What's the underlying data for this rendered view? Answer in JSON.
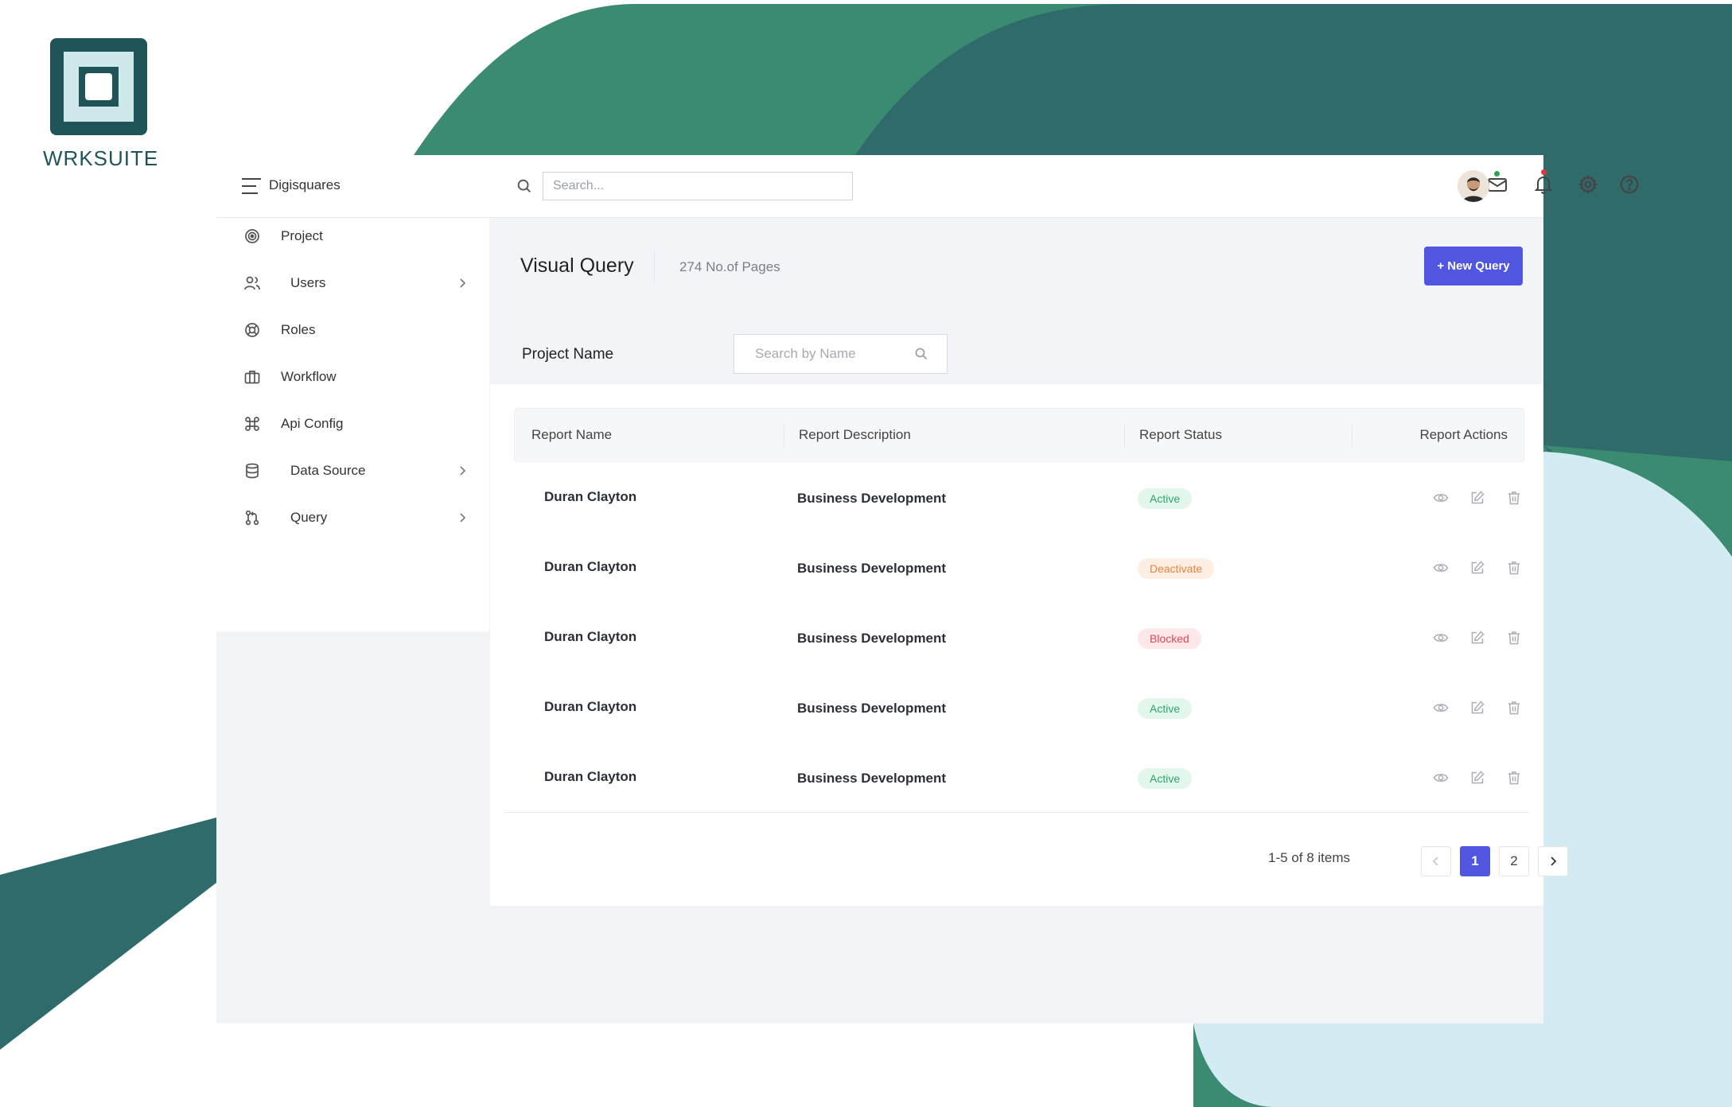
{
  "brand": {
    "name": "WRKSUITE",
    "logo_icon": "square-logo"
  },
  "colors": {
    "accent": "#5156e0",
    "brand_dark": "#1f5558",
    "active": "#29a86a",
    "deactivate": "#e68540",
    "blocked": "#dc4756"
  },
  "topbar": {
    "org_name": "Digisquares",
    "search_placeholder": "Search...",
    "icons": [
      "menu-icon",
      "search-icon",
      "mail-icon",
      "bell-icon",
      "gear-icon",
      "help-icon",
      "avatar"
    ]
  },
  "sidebar": {
    "items": [
      {
        "label": "Project",
        "icon": "target-icon",
        "has_submenu": false
      },
      {
        "label": "Users",
        "icon": "users-icon",
        "has_submenu": true
      },
      {
        "label": "Roles",
        "icon": "lifebuoy-icon",
        "has_submenu": false
      },
      {
        "label": "Workflow",
        "icon": "briefcase-icon",
        "has_submenu": false
      },
      {
        "label": "Api Config",
        "icon": "command-icon",
        "has_submenu": false
      },
      {
        "label": "Data Source",
        "icon": "database-icon",
        "has_submenu": true
      },
      {
        "label": "Query",
        "icon": "git-pull-icon",
        "has_submenu": true
      }
    ]
  },
  "page": {
    "title": "Visual Query",
    "count": "274 No.of Pages",
    "new_button": "+ New Query",
    "filter_label": "Project Name",
    "filter_placeholder": "Search by Name"
  },
  "table": {
    "columns": [
      "Report Name",
      "Report Description",
      "Report Status",
      "Report Actions"
    ],
    "rows": [
      {
        "name": "Duran Clayton",
        "description": "Business Development",
        "status": "Active",
        "status_kind": "active"
      },
      {
        "name": "Duran Clayton",
        "description": "Business Development",
        "status": "Deactivate",
        "status_kind": "deactivate"
      },
      {
        "name": "Duran Clayton",
        "description": "Business Development",
        "status": "Blocked",
        "status_kind": "blocked"
      },
      {
        "name": "Duran Clayton",
        "description": "Business Development",
        "status": "Active",
        "status_kind": "active"
      },
      {
        "name": "Duran Clayton",
        "description": "Business Development",
        "status": "Active",
        "status_kind": "active"
      }
    ],
    "row_actions": [
      "eye-icon",
      "edit-icon",
      "trash-icon"
    ]
  },
  "pagination": {
    "info": "1-5 of 8 items",
    "pages": [
      "1",
      "2"
    ],
    "current": "1"
  }
}
